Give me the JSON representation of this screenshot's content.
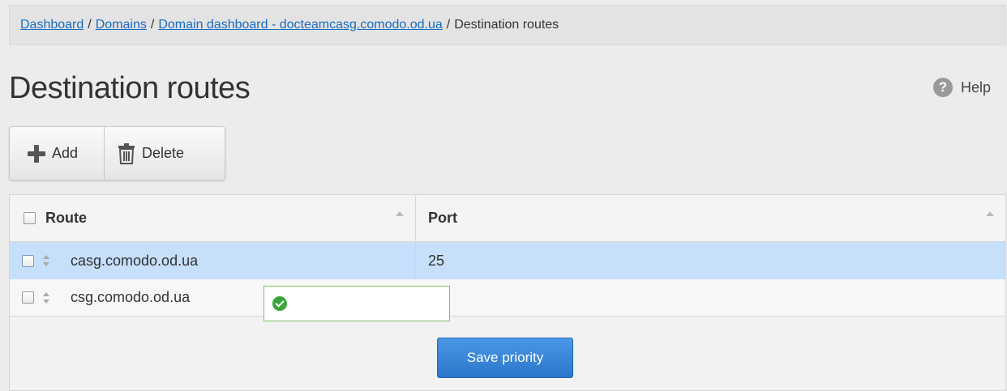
{
  "breadcrumb": {
    "items": [
      {
        "label": "Dashboard"
      },
      {
        "label": "Domains"
      },
      {
        "label": "Domain dashboard - docteamcasg.comodo.od.ua"
      }
    ],
    "current": "Destination routes",
    "separator": "/"
  },
  "page": {
    "title": "Destination routes"
  },
  "help": {
    "icon_glyph": "?",
    "label": "Help"
  },
  "toolbar": {
    "add_label": "Add",
    "delete_label": "Delete"
  },
  "table": {
    "headers": {
      "route": "Route",
      "port": "Port"
    },
    "rows": [
      {
        "route": "casg.comodo.od.ua",
        "port": "25",
        "selected": true
      },
      {
        "route": "csg.comodo.od.ua",
        "port": "",
        "editing": true
      }
    ]
  },
  "actions": {
    "save_priority_label": "Save priority"
  },
  "colors": {
    "link": "#1a6bc4",
    "selected_row": "#c6dffa",
    "primary_button": "#2a77cc",
    "valid": "#3aa63a"
  }
}
